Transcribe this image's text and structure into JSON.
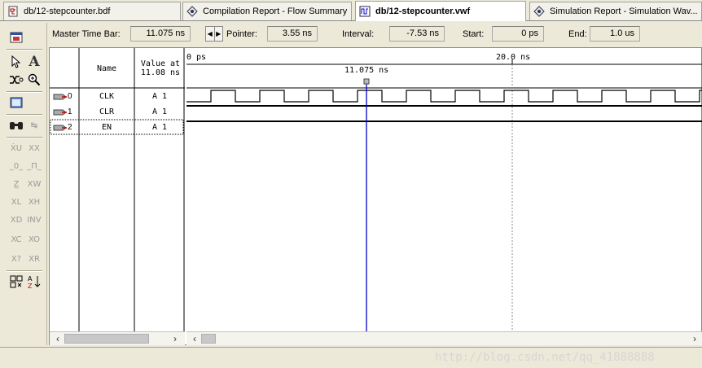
{
  "tabs": [
    {
      "label": "db/12-stepcounter.bdf",
      "icon": "schematic-file-icon",
      "active": false
    },
    {
      "label": "Compilation Report - Flow Summary",
      "icon": "report-icon",
      "active": false
    },
    {
      "label": "db/12-stepcounter.vwf",
      "icon": "waveform-file-icon",
      "active": true
    },
    {
      "label": "Simulation Report - Simulation Wav...",
      "icon": "report-icon",
      "active": false
    }
  ],
  "timebar": {
    "master_label": "Master Time Bar:",
    "master_value": "11.075 ns",
    "pointer_label": "Pointer:",
    "pointer_value": "3.55 ns",
    "interval_label": "Interval:",
    "interval_value": "-7.53 ns",
    "start_label": "Start:",
    "start_value": "0 ps",
    "end_label": "End:",
    "end_value": "1.0 us"
  },
  "table": {
    "name_header": "Name",
    "value_header_1": "Value at",
    "value_header_2": "11.08 ns",
    "signals": [
      {
        "index": "0",
        "name": "CLK",
        "value": "A 1"
      },
      {
        "index": "1",
        "name": "CLR",
        "value": "A 1"
      },
      {
        "index": "2",
        "name": "EN",
        "value": "A 1"
      }
    ]
  },
  "waveform": {
    "scale_start": "0 ps",
    "scale_mark": "20.0 ns",
    "cursor_label": "11.075 ns",
    "accent_color": "#0000c8"
  },
  "watermark": "http://blog.csdn.net/qq_41888888"
}
